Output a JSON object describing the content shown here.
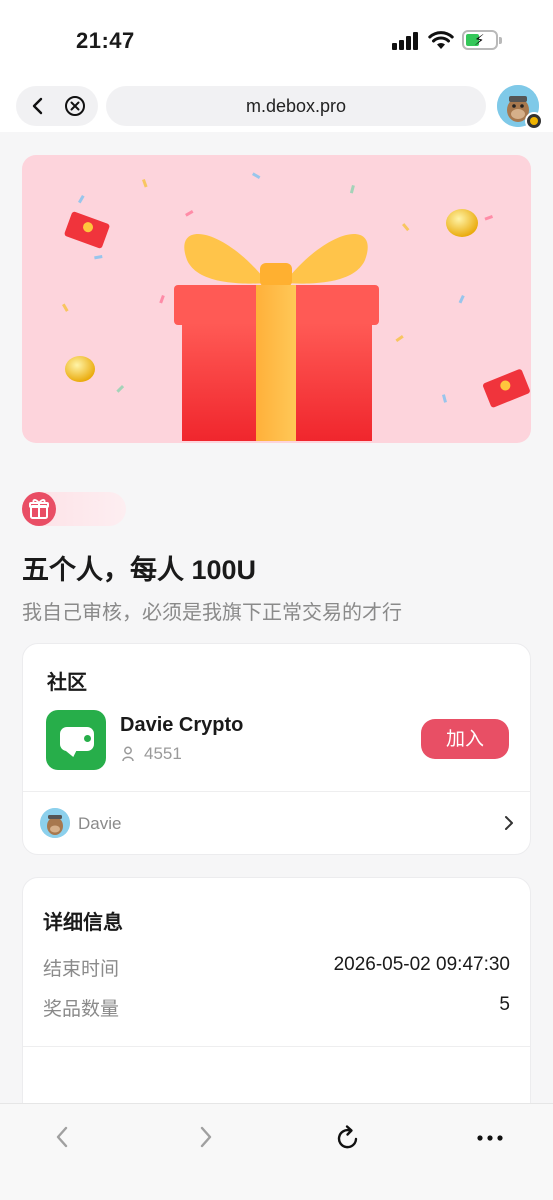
{
  "status_bar": {
    "time": "21:47"
  },
  "browser": {
    "url": "m.debox.pro"
  },
  "giveaway": {
    "title": "五个人，每人 100U",
    "description": "我自己审核，必须是我旗下正常交易的才行"
  },
  "community": {
    "heading": "社区",
    "name": "Davie Crypto",
    "member_count": "4551",
    "join_label": "加入",
    "owner_name": "Davie",
    "accent_color": "#e84f65",
    "app_color": "#27ae4a"
  },
  "details": {
    "heading": "详细信息",
    "rows": [
      {
        "label": "结束时间",
        "value": "2026-05-02 09:47:30"
      },
      {
        "label": "奖品数量",
        "value": "5"
      }
    ]
  },
  "toolbar": {
    "icons": [
      "chevron-left-icon",
      "chevron-right-icon",
      "reload-icon",
      "more-icon"
    ]
  }
}
